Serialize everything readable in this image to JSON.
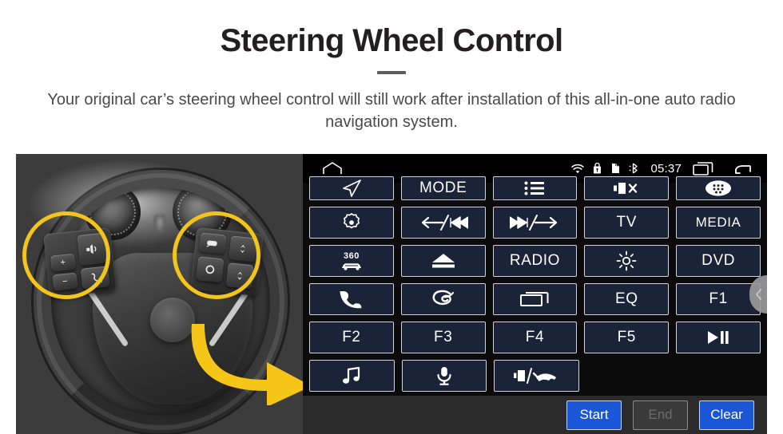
{
  "header": {
    "title": "Steering Wheel Control",
    "subtitle": "Your original car’s steering wheel control will still work after installation of this all-in-one auto radio navigation system."
  },
  "photo": {
    "alt": "steering-wheel-with-controls",
    "highlight_color": "#f2c41c",
    "arrow_color": "#f5c518",
    "left_pad_keys": [
      "+",
      "−",
      "voice",
      "call"
    ],
    "right_pad_keys": [
      "mode",
      "up",
      "circle",
      "down"
    ]
  },
  "headunit": {
    "statusbar": {
      "home_icon": "home-icon",
      "wifi_icon": "wifi-icon",
      "usb_icon": "usb-lock-icon",
      "sdcard_icon": "sd-card-icon",
      "bluetooth_icon": "bluetooth-icon",
      "time": "05:37",
      "recents_icon": "recent-apps-icon",
      "back_icon": "back-arrow-icon"
    },
    "rows": [
      [
        {
          "id": "nav",
          "label": "",
          "icon": "navigation-arrow-icon"
        },
        {
          "id": "mode",
          "label": "MODE",
          "icon": ""
        },
        {
          "id": "list",
          "label": "",
          "icon": "list-menu-icon"
        },
        {
          "id": "mute",
          "label": "",
          "icon": "mute-speaker-icon"
        },
        {
          "id": "apps",
          "label": "",
          "icon": "apps-grid-icon"
        }
      ],
      [
        {
          "id": "settings",
          "label": "",
          "icon": "gear-dot-icon"
        },
        {
          "id": "prev",
          "label": "",
          "icon": "prev-track-icon"
        },
        {
          "id": "next",
          "label": "",
          "icon": "next-track-icon"
        },
        {
          "id": "tv",
          "label": "TV",
          "icon": ""
        },
        {
          "id": "media",
          "label": "MEDIA",
          "icon": ""
        }
      ],
      [
        {
          "id": "cam360",
          "label": "360",
          "icon": "car-360-icon"
        },
        {
          "id": "eject",
          "label": "",
          "icon": "eject-icon"
        },
        {
          "id": "radio",
          "label": "RADIO",
          "icon": ""
        },
        {
          "id": "brightness",
          "label": "",
          "icon": "brightness-sun-icon"
        },
        {
          "id": "dvd",
          "label": "DVD",
          "icon": ""
        }
      ],
      [
        {
          "id": "phone",
          "label": "",
          "icon": "phone-icon"
        },
        {
          "id": "swirl",
          "label": "",
          "icon": "spiral-swirl-icon"
        },
        {
          "id": "screen",
          "label": "",
          "icon": "window-screen-icon"
        },
        {
          "id": "eq",
          "label": "EQ",
          "icon": ""
        },
        {
          "id": "f1",
          "label": "F1",
          "icon": ""
        }
      ],
      [
        {
          "id": "f2",
          "label": "F2",
          "icon": ""
        },
        {
          "id": "f3",
          "label": "F3",
          "icon": ""
        },
        {
          "id": "f4",
          "label": "F4",
          "icon": ""
        },
        {
          "id": "f5",
          "label": "F5",
          "icon": ""
        },
        {
          "id": "playpause",
          "label": "",
          "icon": "play-pause-icon"
        }
      ],
      [
        {
          "id": "music",
          "label": "",
          "icon": "music-note-icon"
        },
        {
          "id": "mic",
          "label": "",
          "icon": "microphone-icon"
        },
        {
          "id": "volhangup",
          "label": "",
          "icon": "volume-hangup-icon"
        },
        {
          "id": "blank1",
          "label": "",
          "icon": ""
        },
        {
          "id": "blank2",
          "label": "",
          "icon": ""
        }
      ]
    ],
    "actions": {
      "start_label": "Start",
      "end_label": "End",
      "clear_label": "Clear",
      "primary_color": "#1a56d6",
      "disabled_color": "#3a3a3a"
    },
    "drawer_tab_icon": "chevron-left-icon"
  }
}
